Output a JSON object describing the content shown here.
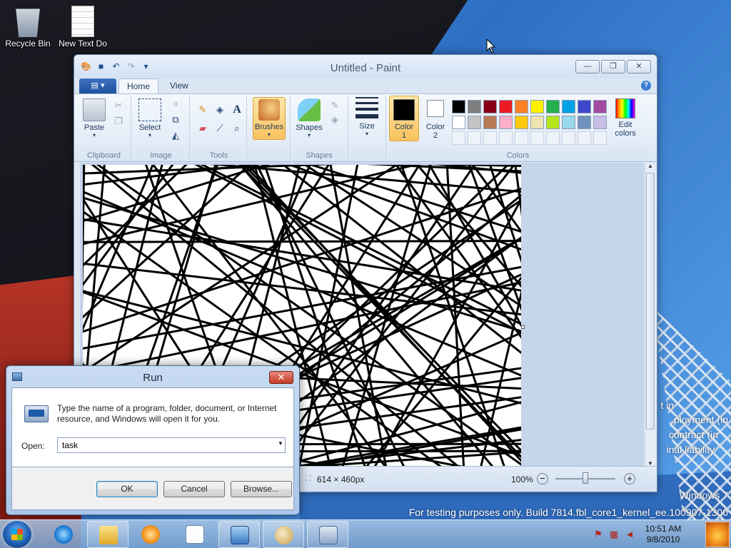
{
  "desktop": {
    "icons": [
      {
        "label": "Recycle Bin"
      },
      {
        "label": "New Text Do"
      }
    ],
    "watermark": {
      "partial1": "t in",
      "partial2": "ployment (in",
      "partial3": "contract (in",
      "partial4": "inal liability.",
      "os": "Windows 7",
      "build": "For testing purposes only. Build 7814.fbl_core1_kernel_ee.100907-1300"
    }
  },
  "paint": {
    "title": "Untitled - Paint",
    "window_buttons": {
      "minimize": "—",
      "maximize": "❐",
      "close": "✕"
    },
    "tabs": {
      "home": "Home",
      "view": "View"
    },
    "help": "?",
    "groups": {
      "clipboard": "Clipboard",
      "image": "Image",
      "tools": "Tools",
      "shapes": "Shapes",
      "colors": "Colors"
    },
    "buttons": {
      "paste": "Paste",
      "select": "Select",
      "brushes": "Brushes",
      "shapes": "Shapes",
      "size": "Size",
      "color1_line1": "Color",
      "color1_line2": "1",
      "color2_line1": "Color",
      "color2_line2": "2",
      "edit_colors_line1": "Edit",
      "edit_colors_line2": "colors"
    },
    "palette_row1": [
      "#000000",
      "#7f7f7f",
      "#880015",
      "#ed1c24",
      "#ff7f27",
      "#fff200",
      "#22b14c",
      "#00a2e8",
      "#3f48cc",
      "#a349a4"
    ],
    "palette_row2": [
      "#ffffff",
      "#c3c3c3",
      "#b97a57",
      "#ffaec9",
      "#ffc90e",
      "#efe4b0",
      "#b5e61d",
      "#99d9ea",
      "#7092be",
      "#c8bfe7"
    ],
    "color1_value": "#000000",
    "color2_value": "#ffffff",
    "status": {
      "size": "614 × 460px",
      "zoom": "100%",
      "zoom_out": "−",
      "zoom_in": "+"
    }
  },
  "run": {
    "title": "Run",
    "close": "✕",
    "description": "Type the name of a program, folder, document, or Internet resource, and Windows will open it for you.",
    "open_label": "Open:",
    "open_value": "task",
    "ok": "OK",
    "cancel": "Cancel",
    "browse": "Browse..."
  },
  "taskbar": {
    "time": "10:51 AM",
    "date": "9/8/2010"
  }
}
